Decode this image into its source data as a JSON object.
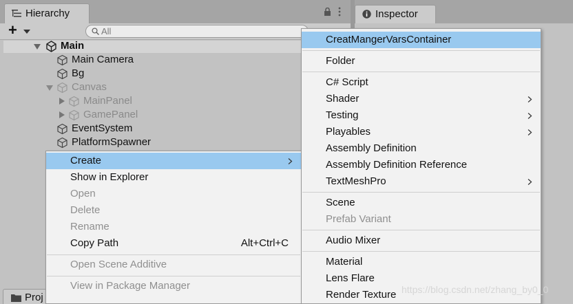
{
  "tabs": {
    "hierarchy_label": "Hierarchy",
    "hierarchy_icon": "hierarchy-list-icon",
    "inspector_label": "Inspector",
    "inspector_icon": "info-icon",
    "project_label": "Proj"
  },
  "toolbar": {
    "add_label": "+",
    "search_placeholder": "All"
  },
  "tree": {
    "scene": "Main",
    "nodes": [
      {
        "label": "Main Camera",
        "active": true
      },
      {
        "label": "Bg",
        "active": true
      },
      {
        "label": "Canvas",
        "active": false,
        "expanded": true
      },
      {
        "label": "MainPanel",
        "active": false,
        "collapsed": true
      },
      {
        "label": "GamePanel",
        "active": false,
        "collapsed": true
      },
      {
        "label": "EventSystem",
        "active": true
      },
      {
        "label": "PlatformSpawner",
        "active": true
      }
    ]
  },
  "context_menu": {
    "items": [
      {
        "label": "Create",
        "highlighted": true,
        "submenu": true
      },
      {
        "label": "Show in Explorer",
        "enabled": true
      },
      {
        "label": "Open",
        "enabled": false
      },
      {
        "label": "Delete",
        "enabled": false
      },
      {
        "label": "Rename",
        "enabled": false
      },
      {
        "label": "Copy Path",
        "enabled": true,
        "shortcut": "Alt+Ctrl+C"
      },
      {
        "label": "Open Scene Additive",
        "enabled": false
      },
      {
        "label": "View in Package Manager",
        "enabled": false
      }
    ]
  },
  "create_submenu": {
    "items": [
      {
        "label": "CreatMangerVarsContainer",
        "highlighted": true
      },
      {
        "label": "Folder"
      },
      {
        "label": "C# Script"
      },
      {
        "label": "Shader",
        "submenu": true
      },
      {
        "label": "Testing",
        "submenu": true
      },
      {
        "label": "Playables",
        "submenu": true
      },
      {
        "label": "Assembly Definition"
      },
      {
        "label": "Assembly Definition Reference"
      },
      {
        "label": "TextMeshPro",
        "submenu": true
      },
      {
        "label": "Scene"
      },
      {
        "label": "Prefab Variant",
        "enabled": false
      },
      {
        "label": "Audio Mixer"
      },
      {
        "label": "Material"
      },
      {
        "label": "Lens Flare"
      },
      {
        "label": "Render Texture"
      }
    ]
  },
  "watermark": "https://blog.csdn.net/zhang_by0_0",
  "colors": {
    "menu_highlight": "#99c9ef",
    "menu_bg": "#f2f2f2",
    "panel_bg": "#c2c2c2",
    "disabled_text": "#8f8f8f"
  }
}
